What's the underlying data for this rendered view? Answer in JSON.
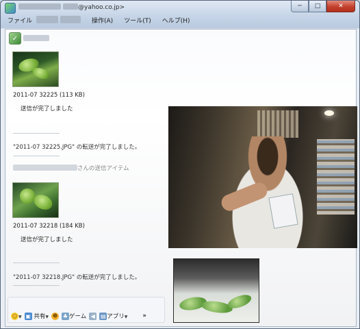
{
  "window": {
    "title_suffix": "@yahoo.co.jp>",
    "buttons": {
      "minimize": "─",
      "maximize": "□",
      "close": "✕"
    }
  },
  "menu": {
    "file": "ファイル",
    "edit": "操作(A)",
    "tools": "ツール(T)",
    "help": "ヘルプ(H)"
  },
  "conversation": {
    "transfers": [
      {
        "file_info": "2011-07 32225 (113 KB)",
        "status": "送信が完了しました",
        "complete_message": "\"2011-07 32225.JPG\" の転送が完了しました。"
      },
      {
        "file_info": "2011-07 32218 (184 KB)",
        "status": "送信が完了しました",
        "complete_message": "\"2011-07 32218.JPG\" の転送が完了しました。"
      }
    ],
    "sender_suffix": "さんの送信アイテム"
  },
  "toolbar": {
    "share_label": "共有",
    "game_label": "ゲーム",
    "app_label": "アプリ",
    "more_label": "»",
    "icons": [
      "emoticon-icon",
      "share-icon",
      "wink-icon",
      "game-icon",
      "sound-icon",
      "app-icon"
    ]
  },
  "colors": {
    "close_button": "#c2402c",
    "client_bg": "#ffffff",
    "frame": "#c6d5e7"
  }
}
